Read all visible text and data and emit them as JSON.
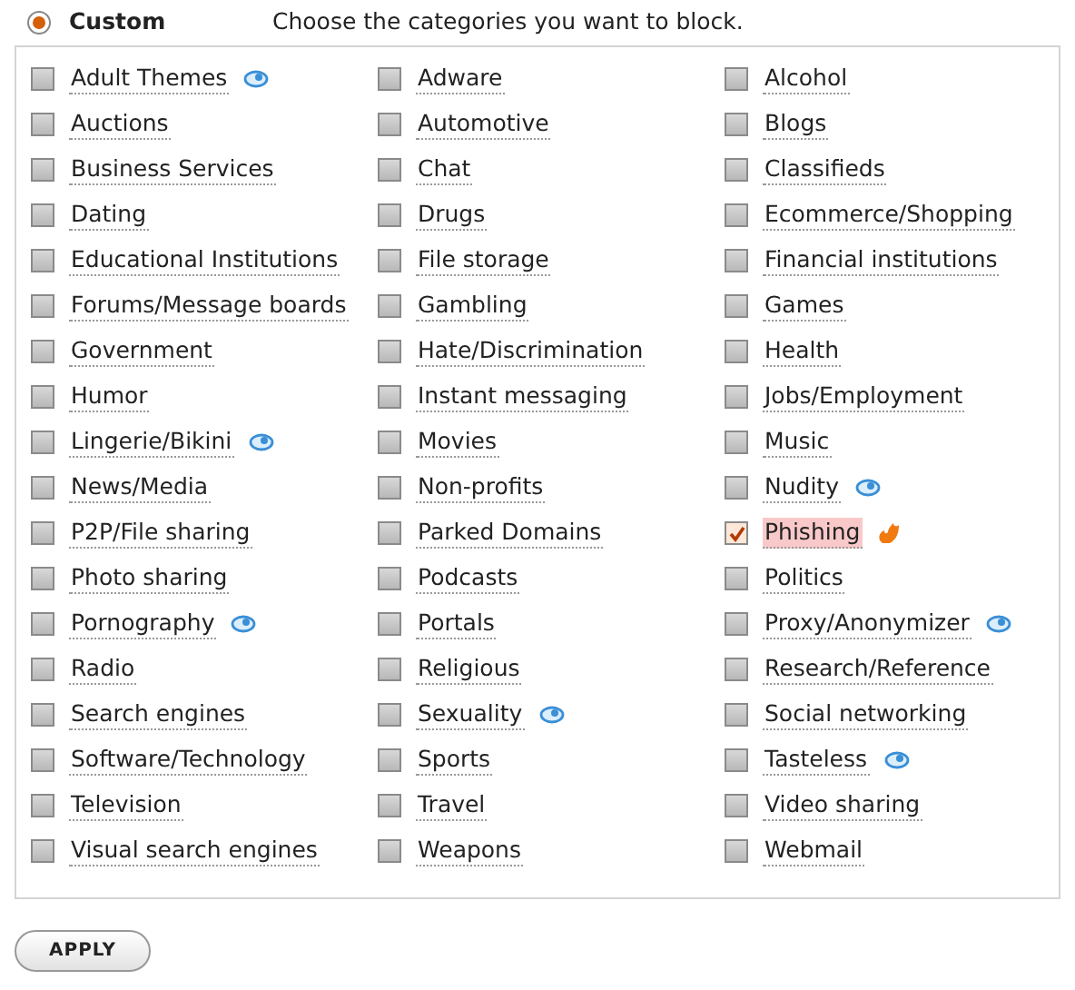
{
  "mode": {
    "label": "Custom",
    "selected": true
  },
  "instruction": "Choose the categories you want to block.",
  "categories": [
    {
      "label": "Adult Themes",
      "checked": false,
      "kind": "flagged"
    },
    {
      "label": "Adware",
      "checked": false,
      "kind": "plain"
    },
    {
      "label": "Alcohol",
      "checked": false,
      "kind": "plain"
    },
    {
      "label": "Auctions",
      "checked": false,
      "kind": "plain"
    },
    {
      "label": "Automotive",
      "checked": false,
      "kind": "plain"
    },
    {
      "label": "Blogs",
      "checked": false,
      "kind": "plain"
    },
    {
      "label": "Business Services",
      "checked": false,
      "kind": "plain"
    },
    {
      "label": "Chat",
      "checked": false,
      "kind": "plain"
    },
    {
      "label": "Classifieds",
      "checked": false,
      "kind": "plain"
    },
    {
      "label": "Dating",
      "checked": false,
      "kind": "plain"
    },
    {
      "label": "Drugs",
      "checked": false,
      "kind": "plain"
    },
    {
      "label": "Ecommerce/Shopping",
      "checked": false,
      "kind": "plain"
    },
    {
      "label": "Educational Institutions",
      "checked": false,
      "kind": "plain"
    },
    {
      "label": "File storage",
      "checked": false,
      "kind": "plain"
    },
    {
      "label": "Financial institutions",
      "checked": false,
      "kind": "plain"
    },
    {
      "label": "Forums/Message boards",
      "checked": false,
      "kind": "plain"
    },
    {
      "label": "Gambling",
      "checked": false,
      "kind": "plain"
    },
    {
      "label": "Games",
      "checked": false,
      "kind": "plain"
    },
    {
      "label": "Government",
      "checked": false,
      "kind": "plain"
    },
    {
      "label": "Hate/Discrimination",
      "checked": false,
      "kind": "plain"
    },
    {
      "label": "Health",
      "checked": false,
      "kind": "plain"
    },
    {
      "label": "Humor",
      "checked": false,
      "kind": "plain"
    },
    {
      "label": "Instant messaging",
      "checked": false,
      "kind": "plain"
    },
    {
      "label": "Jobs/Employment",
      "checked": false,
      "kind": "plain"
    },
    {
      "label": "Lingerie/Bikini",
      "checked": false,
      "kind": "flagged"
    },
    {
      "label": "Movies",
      "checked": false,
      "kind": "plain"
    },
    {
      "label": "Music",
      "checked": false,
      "kind": "plain"
    },
    {
      "label": "News/Media",
      "checked": false,
      "kind": "plain"
    },
    {
      "label": "Non-profits",
      "checked": false,
      "kind": "plain"
    },
    {
      "label": "Nudity",
      "checked": false,
      "kind": "flagged"
    },
    {
      "label": "P2P/File sharing",
      "checked": false,
      "kind": "plain"
    },
    {
      "label": "Parked Domains",
      "checked": false,
      "kind": "plain"
    },
    {
      "label": "Phishing",
      "checked": true,
      "kind": "threat"
    },
    {
      "label": "Photo sharing",
      "checked": false,
      "kind": "plain"
    },
    {
      "label": "Podcasts",
      "checked": false,
      "kind": "plain"
    },
    {
      "label": "Politics",
      "checked": false,
      "kind": "plain"
    },
    {
      "label": "Pornography",
      "checked": false,
      "kind": "flagged"
    },
    {
      "label": "Portals",
      "checked": false,
      "kind": "plain"
    },
    {
      "label": "Proxy/Anonymizer",
      "checked": false,
      "kind": "flagged"
    },
    {
      "label": "Radio",
      "checked": false,
      "kind": "plain"
    },
    {
      "label": "Religious",
      "checked": false,
      "kind": "plain"
    },
    {
      "label": "Research/Reference",
      "checked": false,
      "kind": "plain"
    },
    {
      "label": "Search engines",
      "checked": false,
      "kind": "plain"
    },
    {
      "label": "Sexuality",
      "checked": false,
      "kind": "flagged"
    },
    {
      "label": "Social networking",
      "checked": false,
      "kind": "plain"
    },
    {
      "label": "Software/Technology",
      "checked": false,
      "kind": "plain"
    },
    {
      "label": "Sports",
      "checked": false,
      "kind": "plain"
    },
    {
      "label": "Tasteless",
      "checked": false,
      "kind": "flagged"
    },
    {
      "label": "Television",
      "checked": false,
      "kind": "plain"
    },
    {
      "label": "Travel",
      "checked": false,
      "kind": "plain"
    },
    {
      "label": "Video sharing",
      "checked": false,
      "kind": "plain"
    },
    {
      "label": "Visual search engines",
      "checked": false,
      "kind": "plain"
    },
    {
      "label": "Weapons",
      "checked": false,
      "kind": "plain"
    },
    {
      "label": "Webmail",
      "checked": false,
      "kind": "plain"
    }
  ],
  "apply_button": "APPLY"
}
